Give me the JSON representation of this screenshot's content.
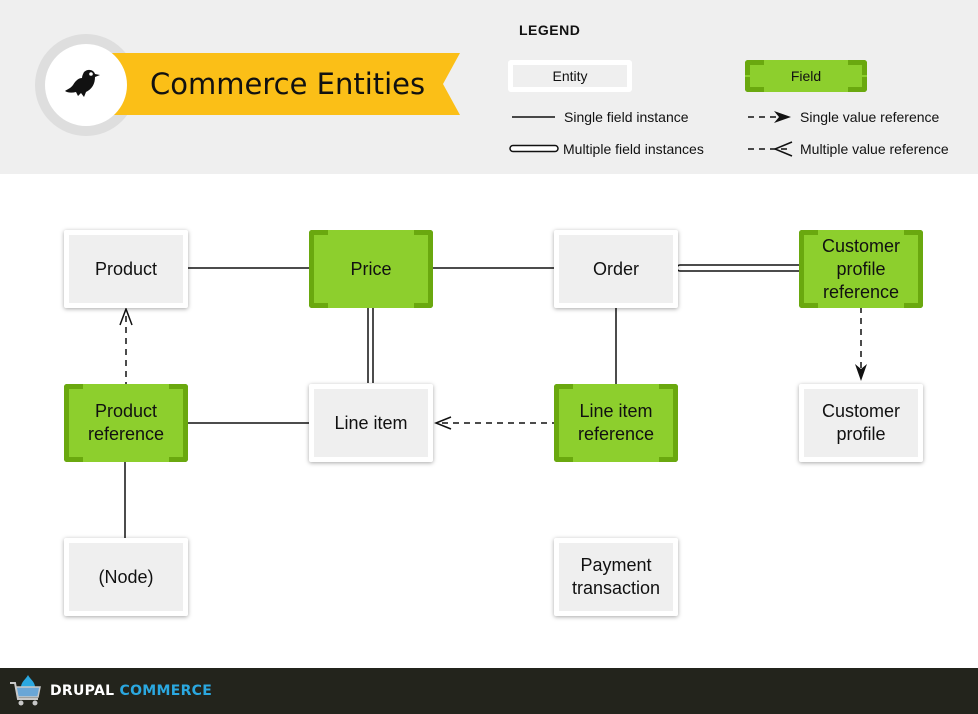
{
  "header": {
    "title": "Commerce Entities",
    "logo_icon": "bird-icon",
    "ribbon_color": "#fbbf17"
  },
  "legend": {
    "title": "LEGEND",
    "entity_label": "Entity",
    "field_label": "Field",
    "single_field_instance": "Single field instance",
    "multiple_field_instances": "Multiple field instances",
    "single_value_reference": "Single value reference",
    "multiple_value_reference": "Multiple value reference"
  },
  "colors": {
    "field_fill": "#8dcf2d",
    "field_corner": "#6aa80f",
    "entity_fill": "#efefef",
    "footer_bg": "#23241c",
    "brand_accent": "#2ba8e0"
  },
  "nodes": {
    "product": {
      "label": "Product",
      "type": "entity"
    },
    "price": {
      "label": "Price",
      "type": "field"
    },
    "order": {
      "label": "Order",
      "type": "entity"
    },
    "customer_profile_reference": {
      "label": "Customer profile reference",
      "type": "field"
    },
    "product_reference": {
      "label": "Product reference",
      "type": "field"
    },
    "line_item": {
      "label": "Line item",
      "type": "entity"
    },
    "line_item_reference": {
      "label": "Line item reference",
      "type": "field"
    },
    "customer_profile": {
      "label": "Customer profile",
      "type": "entity"
    },
    "node": {
      "label": "(Node)",
      "type": "entity"
    },
    "payment_transaction": {
      "label": "Payment transaction",
      "type": "entity"
    }
  },
  "edges": [
    {
      "from": "product",
      "to": "price",
      "kind": "single-field-instance"
    },
    {
      "from": "price",
      "to": "order",
      "kind": "single-field-instance"
    },
    {
      "from": "order",
      "to": "customer_profile_reference",
      "kind": "multiple-field-instances"
    },
    {
      "from": "price",
      "to": "line_item",
      "kind": "multiple-field-instances"
    },
    {
      "from": "order",
      "to": "line_item_reference",
      "kind": "single-field-instance"
    },
    {
      "from": "product_reference",
      "to": "product",
      "kind": "multiple-value-reference"
    },
    {
      "from": "product_reference",
      "to": "line_item",
      "kind": "single-field-instance"
    },
    {
      "from": "line_item_reference",
      "to": "line_item",
      "kind": "multiple-value-reference"
    },
    {
      "from": "customer_profile_reference",
      "to": "customer_profile",
      "kind": "single-value-reference"
    },
    {
      "from": "product_reference",
      "to": "node",
      "kind": "single-field-instance"
    }
  ],
  "footer": {
    "brand_part1": "DRUPAL",
    "brand_part2": "COMMERCE",
    "logo_icon": "shopping-cart-drop-icon"
  }
}
